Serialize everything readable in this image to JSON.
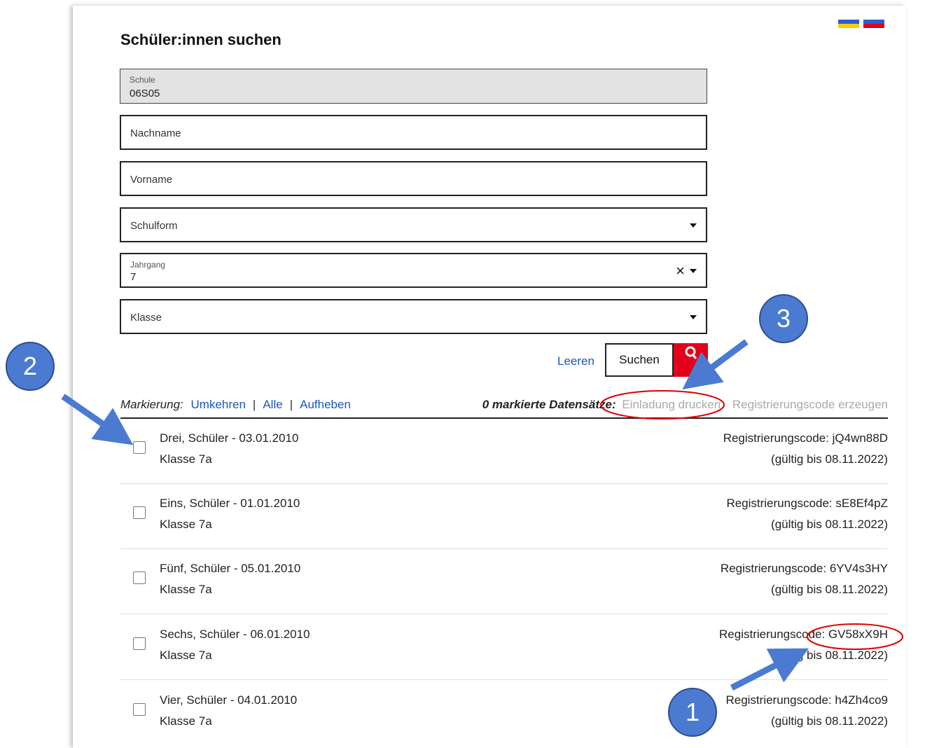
{
  "page": {
    "title": "Schüler:innen suchen"
  },
  "flags": [
    {
      "name": "ukraine-flag",
      "colors": [
        "#2a5fd0",
        "#f5d000"
      ]
    },
    {
      "name": "russia-flag",
      "colors": [
        "#2a5fd0",
        "#e0001a"
      ]
    }
  ],
  "form": {
    "schule": {
      "label": "Schule",
      "value": "06S05"
    },
    "nachname": {
      "placeholder": "Nachname"
    },
    "vorname": {
      "placeholder": "Vorname"
    },
    "schulform": {
      "placeholder": "Schulform"
    },
    "jahrgang": {
      "label": "Jahrgang",
      "value": "7",
      "clear": "×"
    },
    "klasse": {
      "placeholder": "Klasse"
    },
    "leeren_label": "Leeren",
    "suchen_label": "Suchen"
  },
  "markierung": {
    "label": "Markierung:",
    "umkehren": "Umkehren",
    "alle": "Alle",
    "aufheben": "Aufheben",
    "separator": "|",
    "count_text": "0 markierte Datensätze:",
    "einladung": "Einladung drucken",
    "registrierung": "Registrierungscode erzeugen"
  },
  "students": [
    {
      "name": "Drei, Schüler - 03.01.2010",
      "klasse": "Klasse 7a",
      "code": "Registrierungscode: jQ4wn88D",
      "valid": "(gültig bis 08.11.2022)"
    },
    {
      "name": "Eins, Schüler - 01.01.2010",
      "klasse": "Klasse 7a",
      "code": "Registrierungscode: sE8Ef4pZ",
      "valid": "(gültig bis 08.11.2022)"
    },
    {
      "name": "Fünf, Schüler - 05.01.2010",
      "klasse": "Klasse 7a",
      "code": "Registrierungscode: 6YV4s3HY",
      "valid": "(gültig bis 08.11.2022)"
    },
    {
      "name": "Sechs, Schüler - 06.01.2010",
      "klasse": "Klasse 7a",
      "code": "Registrierungscode: GV58xX9H",
      "valid": "(gültig bis 08.11.2022)"
    },
    {
      "name": "Vier, Schüler - 04.01.2010",
      "klasse": "Klasse 7a",
      "code": "Registrierungscode: h4Zh4co9",
      "valid": "(gültig bis 08.11.2022)"
    }
  ],
  "annotations": {
    "badge_1": "1",
    "badge_2": "2",
    "badge_3": "3",
    "color_badge": "#4a7bd1",
    "color_arrow": "#4a7bd1",
    "color_ellipse": "#e00000"
  }
}
